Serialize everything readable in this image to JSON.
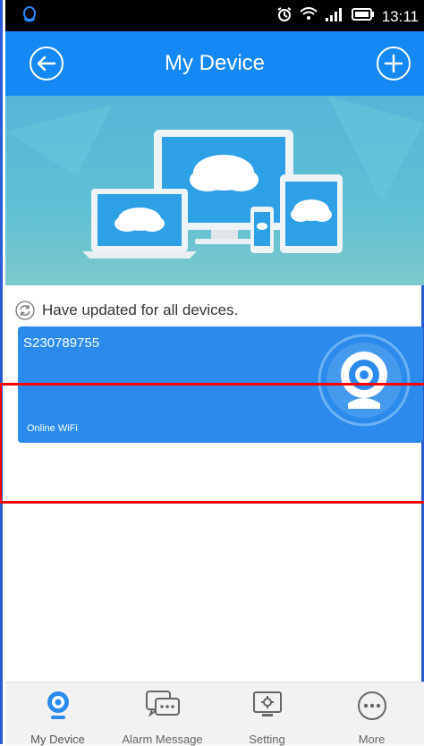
{
  "statusbar": {
    "time": "13:11"
  },
  "header": {
    "title": "My Device"
  },
  "update": {
    "message": "Have updated for all devices."
  },
  "device": {
    "id": "S230789755",
    "status": "Online WiFi"
  },
  "tabs": [
    {
      "label": "My Device"
    },
    {
      "label": "Alarm Message"
    },
    {
      "label": "Setting"
    },
    {
      "label": "More"
    }
  ],
  "colors": {
    "primary": "#1488f4",
    "card": "#2a8bec",
    "highlight": "#ff0000"
  }
}
